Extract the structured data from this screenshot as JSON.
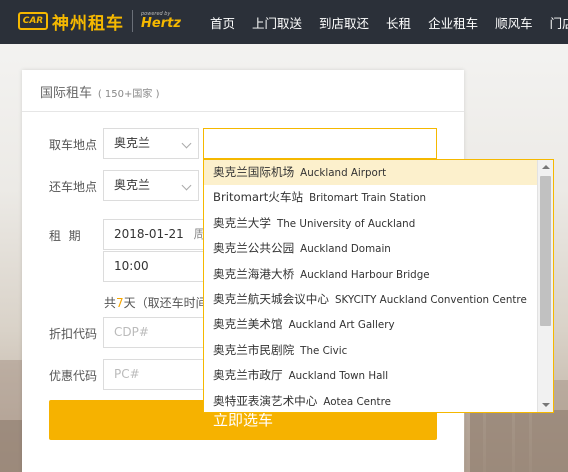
{
  "brand": {
    "logo_mark": "CAR",
    "name": "神州租车",
    "partner_caption": "powered by",
    "partner": "Hertz"
  },
  "nav": [
    "首页",
    "上门取送",
    "到店取还",
    "长租",
    "企业租车",
    "顺风车",
    "门店"
  ],
  "panel": {
    "title": "国际租车",
    "subtitle": "( 150+国家 )"
  },
  "form": {
    "pickup_label": "取车地点",
    "pickup_country": "奥克兰",
    "pickup_location": "",
    "return_label": "还车地点",
    "return_country": "奥克兰",
    "period_label": "租  期",
    "date": "2018-01-21",
    "weekday": "周",
    "time": "10:00",
    "duration_prefix": "共",
    "duration_days": "7",
    "duration_suffix": "天（取还车时间",
    "discount_label": "折扣代码",
    "discount_placeholder": "CDP#",
    "coupon_label": "优惠代码",
    "coupon_placeholder": "PC#",
    "submit_label": "立即选车"
  },
  "dropdown": {
    "items": [
      {
        "zh": "奥克兰国际机场",
        "en": "Auckland Airport"
      },
      {
        "zh": "Britomart火车站",
        "en": "Britomart Train Station"
      },
      {
        "zh": "奥克兰大学",
        "en": "The University of Auckland"
      },
      {
        "zh": "奥克兰公共公园",
        "en": "Auckland Domain"
      },
      {
        "zh": "奥克兰海港大桥",
        "en": "Auckland Harbour Bridge"
      },
      {
        "zh": "奥克兰航天城会议中心",
        "en": "SKYCITY Auckland Convention Centre"
      },
      {
        "zh": "奥克兰美术馆",
        "en": "Auckland Art Gallery"
      },
      {
        "zh": "奥克兰市民剧院",
        "en": "The Civic"
      },
      {
        "zh": "奥克兰市政厅",
        "en": "Auckland Town Hall"
      },
      {
        "zh": "奥特亚表演艺术中心",
        "en": "Aotea Centre"
      }
    ],
    "hovered_index": 0
  },
  "colors": {
    "accent": "#f5b800",
    "header_bg": "#2b3039",
    "hover_bg": "#fcf0cc"
  }
}
